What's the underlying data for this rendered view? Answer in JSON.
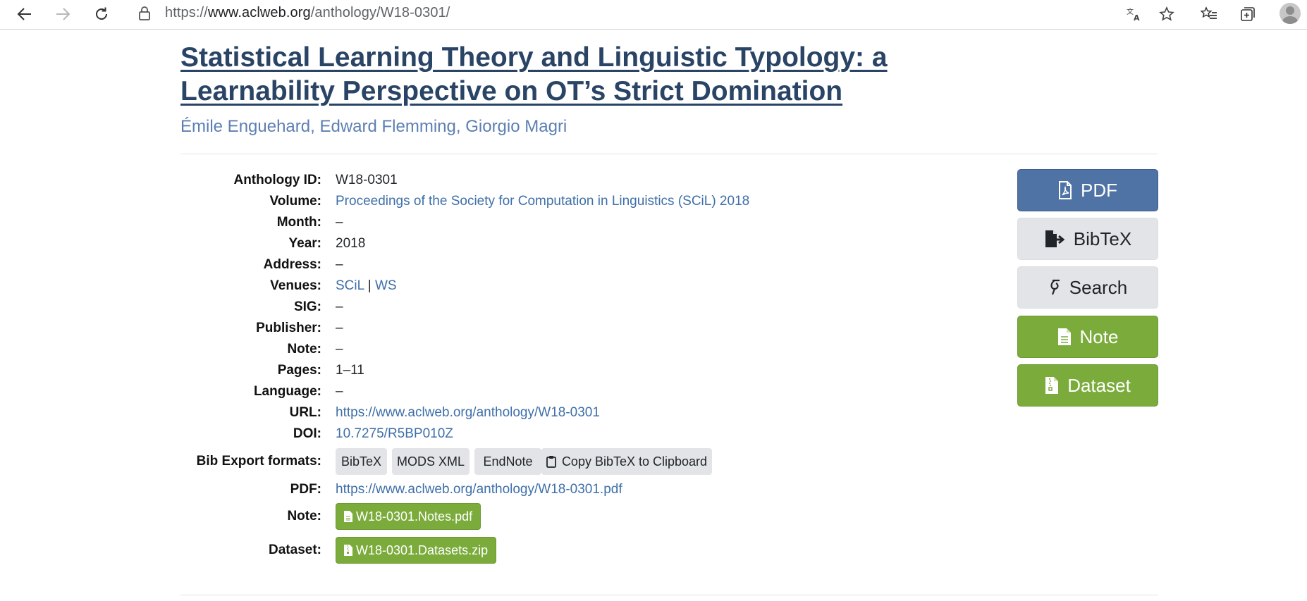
{
  "browser": {
    "url_prefix": "https://",
    "url_host": "www.aclweb.org",
    "url_path": "/anthology/W18-0301/"
  },
  "paper": {
    "title": "Statistical Learning Theory and Linguistic Typology: a Learnability Perspective on OT’s Strict Domination",
    "authors": [
      "Émile Enguehard",
      "Edward Flemming",
      "Giorgio Magri"
    ],
    "author_separator": ", "
  },
  "details": {
    "anthology_id_label": "Anthology ID:",
    "anthology_id": "W18-0301",
    "volume_label": "Volume:",
    "volume": "Proceedings of the Society for Computation in Linguistics (SCiL) 2018",
    "month_label": "Month:",
    "month": "–",
    "year_label": "Year:",
    "year": "2018",
    "address_label": "Address:",
    "address": "–",
    "venues_label": "Venues:",
    "venue_1": "SCiL",
    "venue_sep": "|",
    "venue_2": "WS",
    "sig_label": "SIG:",
    "sig": "–",
    "publisher_label": "Publisher:",
    "publisher": "–",
    "note_label": "Note:",
    "note": "–",
    "pages_label": "Pages:",
    "pages": "1–11",
    "language_label": "Language:",
    "language": "–",
    "url_label": "URL:",
    "url": "https://www.aclweb.org/anthology/W18-0301",
    "doi_label": "DOI:",
    "doi": "10.7275/R5BP010Z",
    "bib_label": "Bib Export formats:",
    "bib_formats": [
      "BibTeX",
      "MODS XML",
      "EndNote",
      "Copy BibTeX to Clipboard"
    ],
    "pdf_label": "PDF:",
    "pdf_url": "https://www.aclweb.org/anthology/W18-0301.pdf",
    "note_file_label": "Note:",
    "note_file": "W18-0301.Notes.pdf",
    "dataset_label": "Dataset:",
    "dataset_file": "W18-0301.Datasets.zip"
  },
  "sidebar": {
    "pdf": "PDF",
    "bibtex": "BibTeX",
    "search": "Search",
    "note": "Note",
    "dataset": "Dataset"
  },
  "colors": {
    "title": "#2a4466",
    "link": "#3e6fa8",
    "primary": "#4f73a4",
    "success": "#7aab3b",
    "secondary": "#e2e4e8"
  },
  "icons": [
    "back-arrow-icon",
    "forward-arrow-icon",
    "reload-icon",
    "lock-icon",
    "translate-icon",
    "star-icon",
    "favorites-icon",
    "collections-icon",
    "profile-icon",
    "file-pdf-icon",
    "file-export-icon",
    "search-engine-icon",
    "file-icon",
    "file-archive-icon",
    "clipboard-icon"
  ]
}
